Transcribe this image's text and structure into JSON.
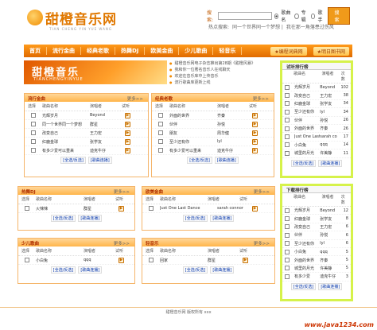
{
  "header": {
    "logo_text": "甜橙音乐网",
    "logo_sub": "TIAN CHENG YIN YUE WANG",
    "search_label": "搜索:",
    "search_value": "",
    "options": [
      "歌曲名",
      "专辑",
      "歌手"
    ],
    "search_button": "搜 索",
    "hot_label": "热点搜索:",
    "hot_items": [
      "同一个世界同一个梦想",
      "我在那一角落患过伤风"
    ]
  },
  "nav": {
    "items": [
      "首页",
      "流行金曲",
      "经典老歌",
      "热舞DJ",
      "欧美金曲",
      "少儿歌曲",
      "轻音乐"
    ],
    "pill1": "★编程词典网",
    "pill2": "★明日图书网"
  },
  "banner": {
    "title": "甜橙音乐",
    "sub": "TIANCHENGYINYUE"
  },
  "news": [
    "甜橙音乐网电子杂志推出第28期《甜橙风暴》",
    "我和你一位著名音乐人在线聊天",
    "欢迎在音乐库中上传音乐",
    "流行歌曲库更新上线"
  ],
  "common": {
    "col_select": "选择",
    "col_song": "歌曲名称",
    "col_artist": "演唱者",
    "col_listen": "试听",
    "more": "更多>>",
    "check_all": "[全选/反选]",
    "play_all": "[歌曲连播]",
    "play_icon": "▶"
  },
  "panels": {
    "pop": {
      "title": "流行金曲",
      "rows": [
        {
          "song": "光辉岁月",
          "artist": "Beyond"
        },
        {
          "song": "同一个世界同一个梦想",
          "artist": "群星"
        },
        {
          "song": "改变自己",
          "artist": "王力宏"
        },
        {
          "song": "红鹿金球",
          "artist": "张学友"
        },
        {
          "song": "有多少爱可以重来",
          "artist": "迪克牛仔"
        }
      ]
    },
    "classic": {
      "title": "经典老歌",
      "rows": [
        {
          "song": "外面的世界",
          "artist": "齐秦"
        },
        {
          "song": "伙伴",
          "artist": "孙悦"
        },
        {
          "song": "朋友",
          "artist": "周华健"
        },
        {
          "song": "至少还有你",
          "artist": "lyl"
        },
        {
          "song": "有多少爱可以重来",
          "artist": "迪克牛仔"
        }
      ]
    },
    "dj": {
      "title": "热舞DJ",
      "rows": [
        {
          "song": "火辣辣",
          "artist": "群星"
        }
      ]
    },
    "western": {
      "title": "欧美金曲",
      "rows": [
        {
          "song": "Just One Last Dance",
          "artist": "sarah connor"
        }
      ]
    },
    "kids": {
      "title": "少儿歌曲",
      "rows": [
        {
          "song": "小白兔",
          "artist": "qqq"
        }
      ]
    },
    "light": {
      "title": "轻音乐",
      "rows": [
        {
          "song": "回家",
          "artist": "群星"
        }
      ]
    }
  },
  "listen_rank": {
    "title": "试听排行榜",
    "cols": [
      "歌曲名",
      "演唱者",
      "次数"
    ],
    "rows": [
      {
        "song": "光辉岁月",
        "artist": "Beyond",
        "count": "102"
      },
      {
        "song": "改变自己",
        "artist": "王力宏",
        "count": "38"
      },
      {
        "song": "红鹿金球",
        "artist": "张学友",
        "count": "34"
      },
      {
        "song": "至少还有你",
        "artist": "lyl",
        "count": "34"
      },
      {
        "song": "伙伴",
        "artist": "孙悦",
        "count": "26"
      },
      {
        "song": "外面的世界",
        "artist": "齐秦",
        "count": "26"
      },
      {
        "song": "Just One Last",
        "artist": "sarah connor",
        "count": "17"
      },
      {
        "song": "小白兔",
        "artist": "qqq",
        "count": "14"
      },
      {
        "song": "城里的月光",
        "artist": "许美静",
        "count": "11"
      }
    ]
  },
  "download_rank": {
    "title": "下载排行榜",
    "cols": [
      "歌曲名",
      "演唱者",
      "次数"
    ],
    "rows": [
      {
        "song": "光辉岁月",
        "artist": "Beyond",
        "count": "12"
      },
      {
        "song": "红鹿金球",
        "artist": "张学友",
        "count": "8"
      },
      {
        "song": "改变自己",
        "artist": "王力宏",
        "count": "6"
      },
      {
        "song": "伙伴",
        "artist": "孙悦",
        "count": "6"
      },
      {
        "song": "至少还有你",
        "artist": "lyl",
        "count": "6"
      },
      {
        "song": "小白兔",
        "artist": "qqq",
        "count": "5"
      },
      {
        "song": "外面的世界",
        "artist": "齐秦",
        "count": "5"
      },
      {
        "song": "城里的月光",
        "artist": "许美静",
        "count": "5"
      },
      {
        "song": "有多少爱",
        "artist": "迪克牛仔",
        "count": "3"
      }
    ]
  },
  "footer": {
    "text": "甜橙音乐网 版权所有 xxx"
  },
  "watermark": "www.java1234.com"
}
